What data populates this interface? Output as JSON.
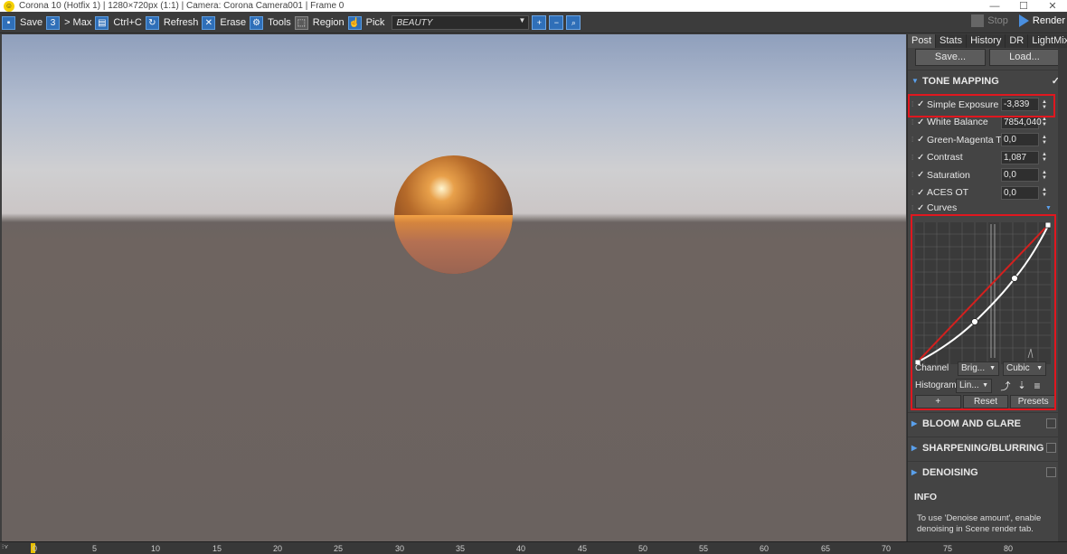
{
  "window": {
    "title": "Corona 10 (Hotfix 1) | 1280×720px (1:1) | Camera: Corona Camera001 | Frame 0",
    "minimize": "—",
    "maximize": "☐",
    "close": "✕"
  },
  "toolbar": {
    "save": "Save",
    "max": "> Max",
    "ctrlc": "Ctrl+C",
    "refresh": "Refresh",
    "erase": "Erase",
    "tools": "Tools",
    "region": "Region",
    "pick": "Pick",
    "render_element": "BEAUTY",
    "stop": "Stop",
    "render": "Render"
  },
  "panel": {
    "tabs": [
      "Post",
      "Stats",
      "History",
      "DR",
      "LightMix"
    ],
    "active_tab": "Post",
    "save_button": "Save...",
    "load_button": "Load...",
    "tone_mapping": {
      "title": "TONE MAPPING",
      "enabled": true,
      "params": [
        {
          "label": "Simple Exposure",
          "value": "-3,839",
          "checked": true
        },
        {
          "label": "White Balance",
          "value": "7854,040",
          "checked": true
        },
        {
          "label": "Green-Magenta Tint",
          "value": "0,0",
          "checked": true
        },
        {
          "label": "Contrast",
          "value": "1,087",
          "checked": true
        },
        {
          "label": "Saturation",
          "value": "0,0",
          "checked": true
        },
        {
          "label": "ACES OT",
          "value": "0,0",
          "checked": true
        }
      ],
      "curves_label": "Curves"
    },
    "curves": {
      "channel_label": "Channel",
      "channel_value": "Brig...",
      "interp_value": "Cubic",
      "histogram_label": "Histogram",
      "histogram_value": "Lin...",
      "add_button": "+",
      "reset_button": "Reset",
      "presets_button": "Presets"
    },
    "sections": [
      {
        "title": "BLOOM AND GLARE"
      },
      {
        "title": "SHARPENING/BLURRING"
      },
      {
        "title": "DENOISING"
      }
    ],
    "info": {
      "title": "INFO",
      "text": "To use 'Denoise amount', enable denoising in Scene render tab."
    }
  },
  "timeline": {
    "ticks": [
      "0",
      "5",
      "10",
      "15",
      "20",
      "25",
      "30",
      "35",
      "40",
      "45",
      "50",
      "55",
      "60",
      "65",
      "70",
      "75",
      "80"
    ],
    "current_frame": "0"
  },
  "colors": {
    "accent": "#2f6fb8",
    "highlight": "#e0171f"
  }
}
